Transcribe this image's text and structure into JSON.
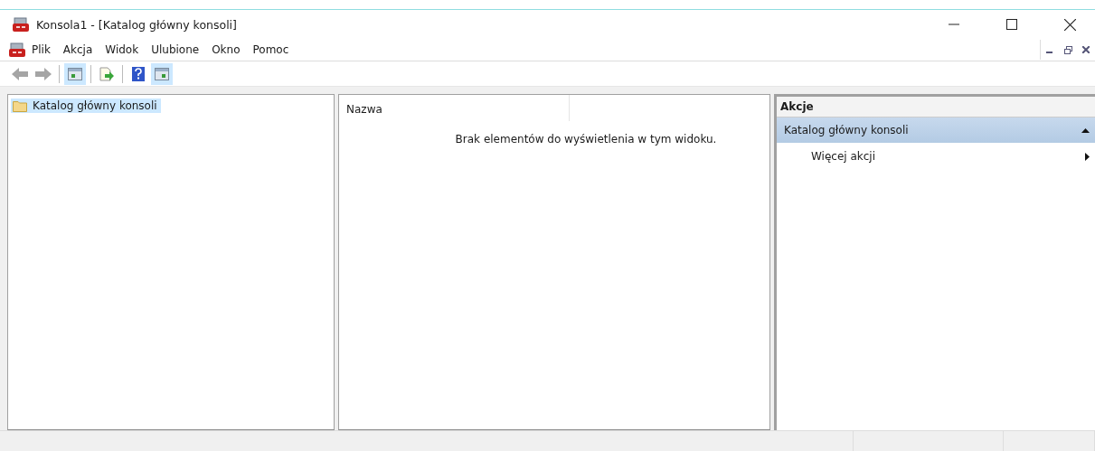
{
  "window": {
    "title": "Konsola1 - [Katalog główny konsoli]"
  },
  "menu": [
    {
      "label": "Plik"
    },
    {
      "label": "Akcja"
    },
    {
      "label": "Widok"
    },
    {
      "label": "Ulubione"
    },
    {
      "label": "Okno"
    },
    {
      "label": "Pomoc"
    }
  ],
  "toolbar": [
    {
      "kind": "back",
      "disabled": true
    },
    {
      "kind": "forward",
      "disabled": true
    },
    {
      "kind": "sep"
    },
    {
      "kind": "tree",
      "selected": true
    },
    {
      "kind": "sep"
    },
    {
      "kind": "export",
      "selected": false
    },
    {
      "kind": "sep"
    },
    {
      "kind": "help",
      "selected": false
    },
    {
      "kind": "pane",
      "selected": true
    }
  ],
  "tree": [
    {
      "label": "Katalog główny konsoli",
      "selected": true
    }
  ],
  "list": {
    "columns": [
      "Nazwa"
    ],
    "empty_message": "Brak elementów do wyświetlenia w tym widoku."
  },
  "actions": {
    "title": "Akcje",
    "sections": [
      {
        "label": "Katalog główny konsoli",
        "expanded": true,
        "items": [
          {
            "label": "Więcej akcji"
          }
        ]
      }
    ]
  }
}
